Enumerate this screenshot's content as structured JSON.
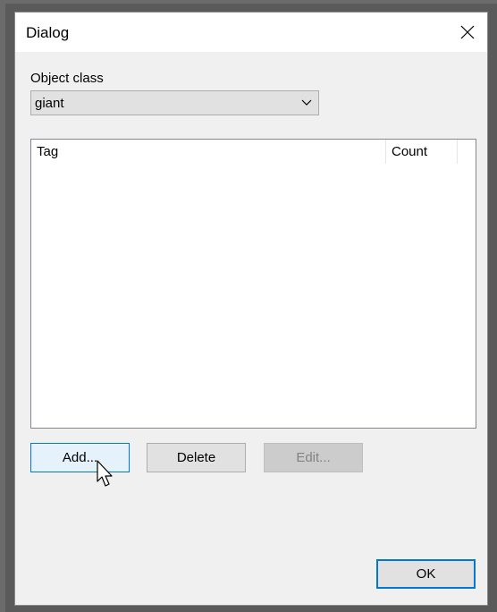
{
  "window": {
    "title": "Dialog",
    "close_icon": "close-icon"
  },
  "object_class": {
    "label": "Object class",
    "selected": "giant"
  },
  "tag_list": {
    "columns": [
      "Tag",
      "Count"
    ],
    "rows": []
  },
  "buttons": {
    "add": "Add...",
    "delete": "Delete",
    "edit": "Edit...",
    "ok": "OK"
  },
  "colors": {
    "accent": "#0078d7",
    "dialog_bg": "#f0f0f0",
    "disabled_text": "#838383"
  }
}
